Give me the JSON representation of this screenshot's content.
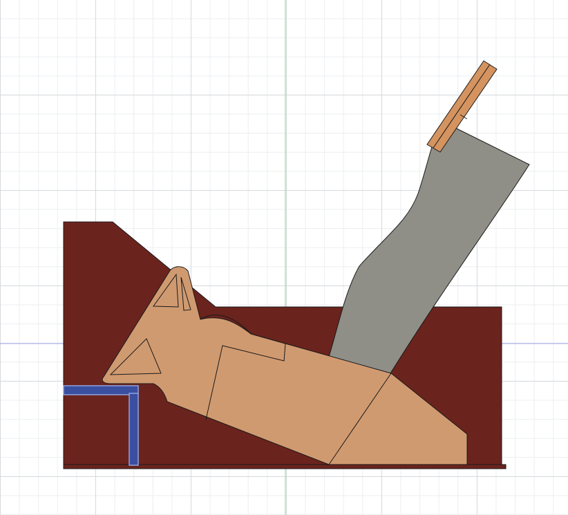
{
  "viewport": {
    "background": "#ffffff",
    "grid_major_color": "#d6d9dd",
    "grid_minor_color": "#eceef0",
    "axis_vertical_color": "#8fd68f",
    "axis_horizontal_color": "#9aa0e6"
  },
  "model": {
    "base_color": "#6b231e",
    "body_color": "#d09a70",
    "blade_color": "#8f8f88",
    "handle_color": "#d4935f",
    "selection_color": "#3a4f9f",
    "edge_color": "#1a1a1a"
  }
}
